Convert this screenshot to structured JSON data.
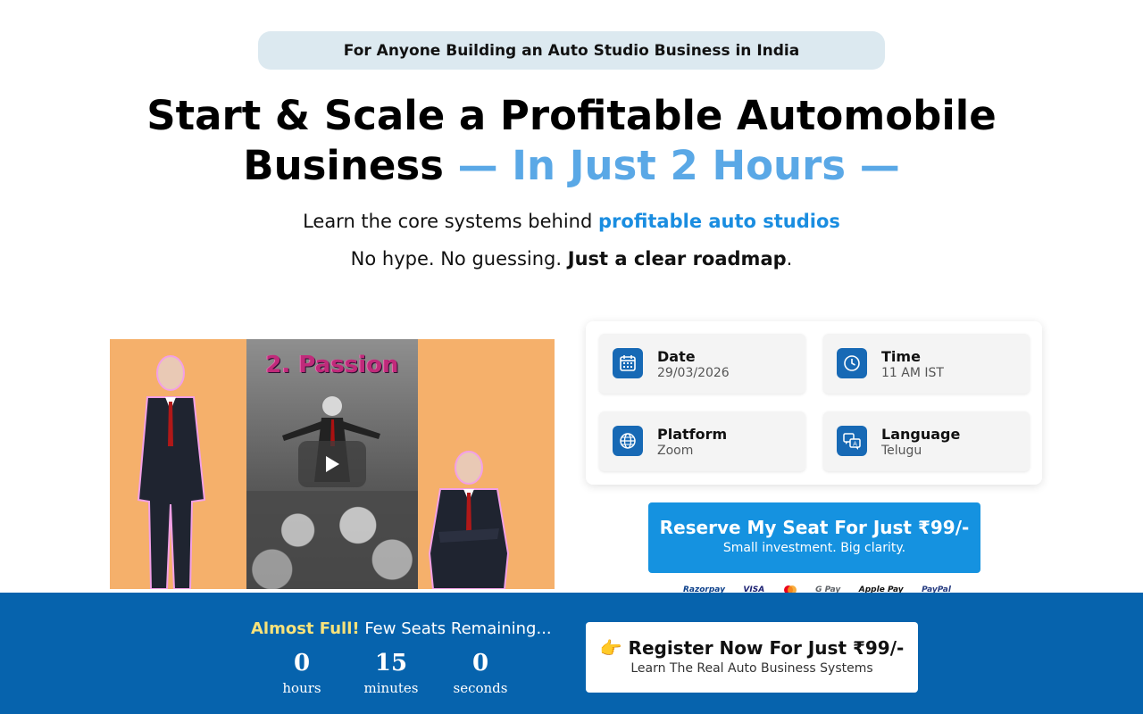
{
  "badge": "For Anyone Building an Auto Studio Business in India",
  "headline": {
    "line1": "Start & Scale a Profitable Automobile",
    "line2_black": "Business",
    "line2_accent": "— In Just 2 Hours —"
  },
  "subtitle1": {
    "text": "Learn the core systems behind",
    "highlight": "profitable auto studios"
  },
  "subtitle2": {
    "text": "No hype. No guessing.",
    "bold": "Just a clear roadmap",
    "end": "."
  },
  "video": {
    "caption": "2. Passion",
    "play_icon": "play-icon"
  },
  "details": [
    {
      "label": "Date",
      "value": "29/03/2026",
      "icon": "calendar-icon"
    },
    {
      "label": "Time",
      "value": "11 AM IST",
      "icon": "clock-icon"
    },
    {
      "label": "Platform",
      "value": "Zoom",
      "icon": "globe-icon"
    },
    {
      "label": "Language",
      "value": "Telugu",
      "icon": "translate-icon"
    }
  ],
  "reserve": {
    "label": "Reserve My Seat For Just ₹99/-",
    "sub": "Small investment. Big clarity."
  },
  "payments": [
    "Razorpay",
    "VISA",
    "Mastercard",
    "G Pay",
    "Apple Pay",
    "PayPal"
  ],
  "bottom_bar": {
    "almost_hl": "Almost Full!",
    "almost_text": "Few Seats Remaining...",
    "countdown": [
      {
        "value": "0",
        "unit": "hours"
      },
      {
        "value": "15",
        "unit": "minutes"
      },
      {
        "value": "0",
        "unit": "seconds"
      }
    ],
    "register_label": "👉 Register Now For Just ₹99/-",
    "register_sub": "Learn The Real Auto Business Systems"
  },
  "colors": {
    "brand_blue": "#0663ad",
    "cta_blue": "#1592e0",
    "accent_light_blue": "#5aa8e6",
    "highlight_yellow": "#f7e27a"
  }
}
